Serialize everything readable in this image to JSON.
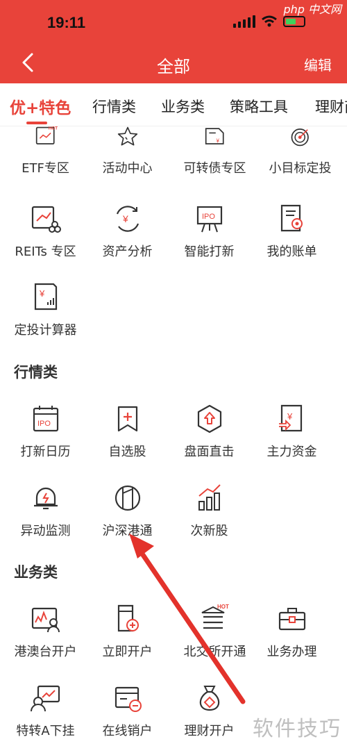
{
  "status": {
    "time": "19:11"
  },
  "watermark_top": "php 中文网",
  "watermark_bottom": "软件技巧",
  "nav": {
    "title": "全部",
    "edit": "编辑"
  },
  "tabs": [
    "优+特色",
    "行情类",
    "业务类",
    "策略工具",
    "理财商"
  ],
  "featured": [
    {
      "label": "ETF专区",
      "icon": "etf-hot-icon",
      "badge": "HOT"
    },
    {
      "label": "活动中心",
      "icon": "star-icon"
    },
    {
      "label": "可转债专区",
      "icon": "bond-icon"
    },
    {
      "label": "小目标定投",
      "icon": "target-icon"
    },
    {
      "label": "REITs 专区",
      "icon": "reits-icon"
    },
    {
      "label": "资产分析",
      "icon": "asset-analysis-icon"
    },
    {
      "label": "智能打新",
      "icon": "ipo-board-icon"
    },
    {
      "label": "我的账单",
      "icon": "bill-icon"
    },
    {
      "label": "定投计算器",
      "icon": "calculator-icon"
    }
  ],
  "market": {
    "title": "行情类",
    "items": [
      {
        "label": "打新日历",
        "icon": "ipo-calendar-icon"
      },
      {
        "label": "自选股",
        "icon": "bookmark-add-icon"
      },
      {
        "label": "盘面直击",
        "icon": "hexagon-up-icon"
      },
      {
        "label": "主力资金",
        "icon": "fund-flow-icon"
      },
      {
        "label": "异动监测",
        "icon": "bell-alert-icon"
      },
      {
        "label": "沪深港通",
        "icon": "connect-icon"
      },
      {
        "label": "次新股",
        "icon": "growth-bars-icon"
      }
    ]
  },
  "business": {
    "title": "业务类",
    "items": [
      {
        "label": "港澳台开户",
        "icon": "id-card-icon"
      },
      {
        "label": "立即开户",
        "icon": "open-account-icon"
      },
      {
        "label": "北交所开通",
        "icon": "exchange-hot-icon",
        "badge": "HOT"
      },
      {
        "label": "业务办理",
        "icon": "briefcase-icon"
      },
      {
        "label": "特转A下挂",
        "icon": "transfer-icon"
      },
      {
        "label": "在线销户",
        "icon": "close-account-icon"
      },
      {
        "label": "理财开户",
        "icon": "money-bag-icon"
      }
    ]
  },
  "colors": {
    "brand": "#e8433a",
    "text": "#333333"
  }
}
